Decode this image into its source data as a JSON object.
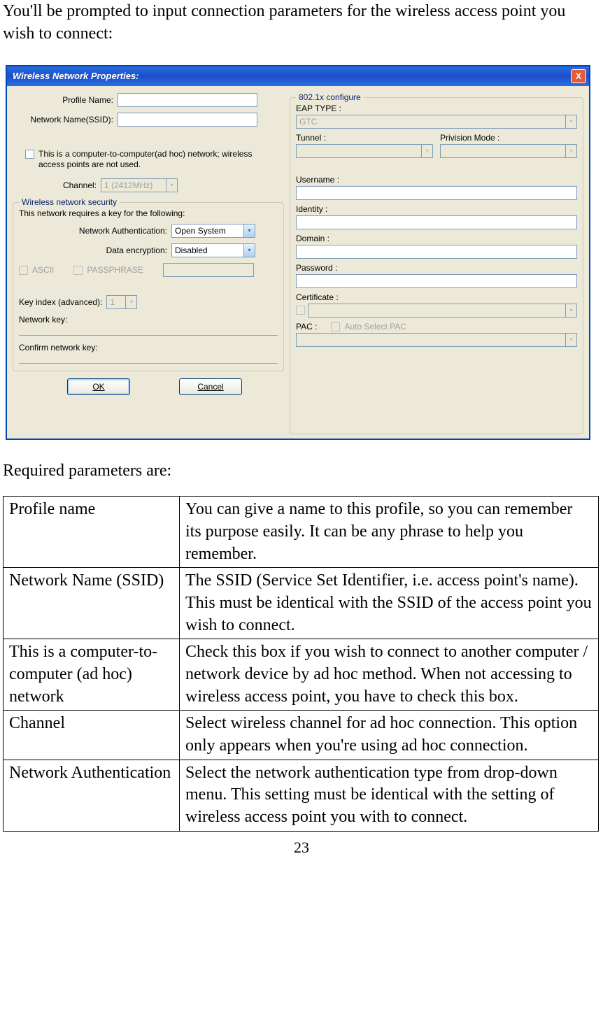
{
  "intro": "You'll be prompted to input connection parameters for the wireless access point you wish to connect:",
  "post": "Required parameters are:",
  "page_number": "23",
  "dialog": {
    "title": "Wireless Network Properties:",
    "close": "X",
    "profile_name_label": "Profile Name:",
    "ssid_label": "Network Name(SSID):",
    "adhoc_label": "This is a computer-to-computer(ad hoc) network; wireless access points are not used.",
    "channel_label": "Channel:",
    "channel_value": "1 (2412MHz)",
    "security_legend": "Wireless network security",
    "security_desc": "This network requires a key for the following:",
    "net_auth_label": "Network Authentication:",
    "net_auth_value": "Open System",
    "data_enc_label": "Data encryption:",
    "data_enc_value": "Disabled",
    "ascii_label": "ASCII",
    "passphrase_label": "PASSPHRASE",
    "key_index_label": "Key index (advanced):",
    "key_index_value": "1",
    "network_key_label": "Network key:",
    "confirm_key_label": "Confirm network key:",
    "config_legend": "802.1x configure",
    "eap_type_label": "EAP TYPE :",
    "eap_type_value": "GTC",
    "tunnel_label": "Tunnel :",
    "privision_label": "Privision Mode :",
    "username_label": "Username :",
    "identity_label": "Identity :",
    "domain_label": "Domain :",
    "password_label": "Password :",
    "certificate_label": "Certificate :",
    "pac_label": "PAC :",
    "auto_pac_label": "Auto Select PAC",
    "ok_label": "OK",
    "cancel_label": "Cancel"
  },
  "table": [
    {
      "name": "Profile name",
      "desc": "You can give a name to this profile, so you can remember its purpose easily. It can be any phrase to help you remember."
    },
    {
      "name": "Network Name (SSID)",
      "desc": "The SSID (Service Set Identifier, i.e. access point's name). This must be identical with the SSID of the access point you wish to connect."
    },
    {
      "name": "This is a computer-to-computer (ad hoc) network",
      "desc": "Check this box if you wish to connect to another computer / network device by ad hoc method. When not accessing to wireless access point, you have to check this box."
    },
    {
      "name": "Channel",
      "desc": "Select wireless channel for ad hoc connection. This option only appears when you're using ad hoc connection."
    },
    {
      "name": "Network Authentication",
      "desc": "Select the network authentication type from drop-down menu. This setting must be identical with the setting of wireless access point you with to connect."
    }
  ]
}
